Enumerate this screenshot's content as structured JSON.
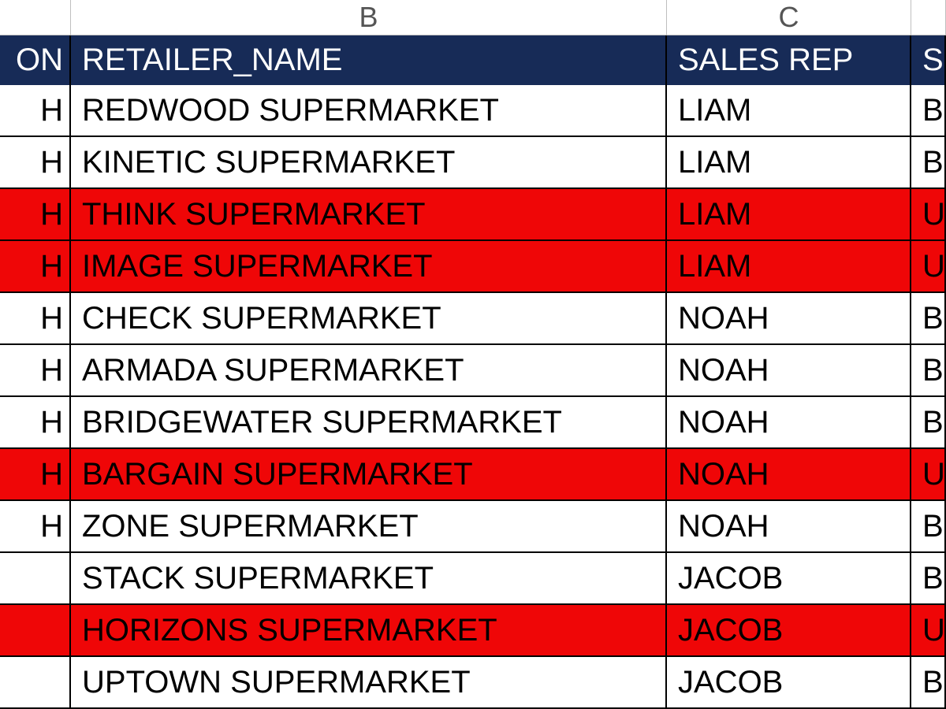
{
  "column_letters": {
    "b": "B",
    "c": "C"
  },
  "headers": {
    "a": "ON",
    "b": "RETAILER_NAME",
    "c": "SALES REP",
    "d": "S"
  },
  "rows": [
    {
      "a": "H",
      "b": "REDWOOD SUPERMARKET",
      "c": "LIAM",
      "d": "B",
      "highlighted": false
    },
    {
      "a": "H",
      "b": "KINETIC SUPERMARKET",
      "c": "LIAM",
      "d": "B",
      "highlighted": false
    },
    {
      "a": "H",
      "b": "THINK SUPERMARKET",
      "c": "LIAM",
      "d": "U",
      "highlighted": true
    },
    {
      "a": "H",
      "b": "IMAGE SUPERMARKET",
      "c": "LIAM",
      "d": "U",
      "highlighted": true
    },
    {
      "a": "H",
      "b": "CHECK SUPERMARKET",
      "c": "NOAH",
      "d": "B",
      "highlighted": false
    },
    {
      "a": "H",
      "b": "ARMADA SUPERMARKET",
      "c": "NOAH",
      "d": "B",
      "highlighted": false
    },
    {
      "a": "H",
      "b": "BRIDGEWATER SUPERMARKET",
      "c": "NOAH",
      "d": "B",
      "highlighted": false
    },
    {
      "a": "H",
      "b": "BARGAIN SUPERMARKET",
      "c": "NOAH",
      "d": "U",
      "highlighted": true
    },
    {
      "a": "H",
      "b": "ZONE SUPERMARKET",
      "c": "NOAH",
      "d": "B",
      "highlighted": false
    },
    {
      "a": "",
      "b": "STACK SUPERMARKET",
      "c": "JACOB",
      "d": "B",
      "highlighted": false
    },
    {
      "a": "",
      "b": "HORIZONS SUPERMARKET",
      "c": "JACOB",
      "d": "U",
      "highlighted": true
    },
    {
      "a": "",
      "b": "UPTOWN SUPERMARKET",
      "c": "JACOB",
      "d": "B",
      "highlighted": false
    }
  ]
}
